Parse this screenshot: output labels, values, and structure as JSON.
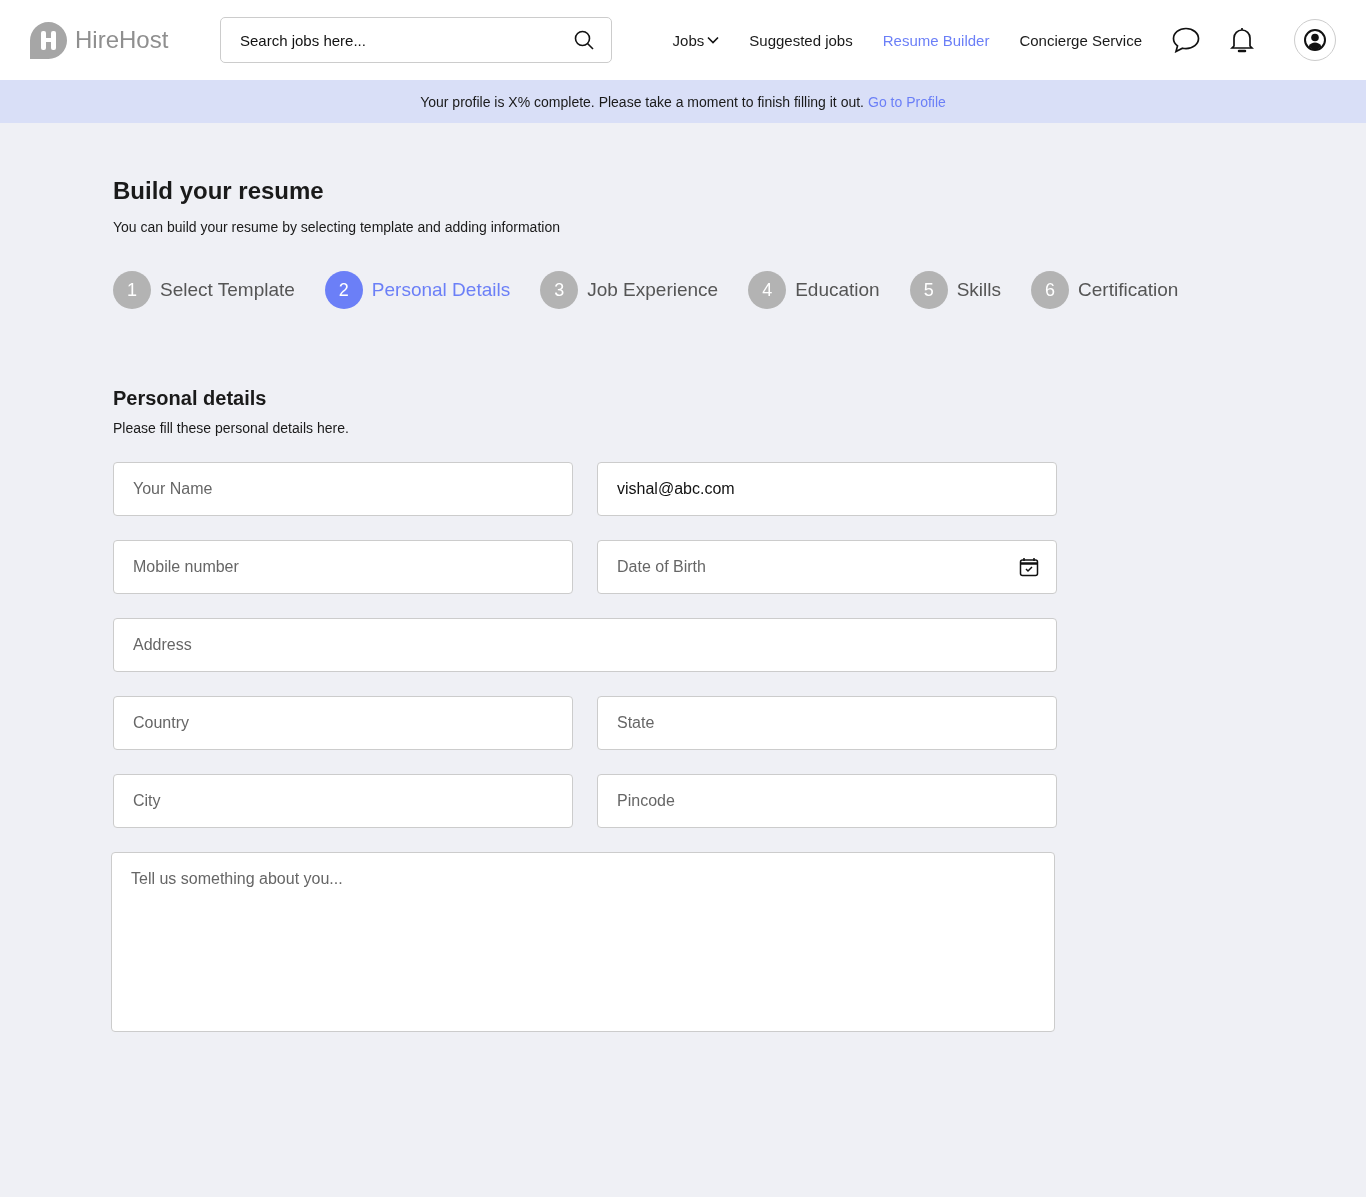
{
  "header": {
    "logo": "HireHost",
    "search": {
      "placeholder": "Search jobs here..."
    },
    "nav": [
      {
        "label": "Jobs",
        "kind": "dropdown",
        "selected": false
      },
      {
        "label": "Suggested jobs",
        "kind": "link",
        "selected": false
      },
      {
        "label": "Resume Builder",
        "kind": "link",
        "selected": true
      },
      {
        "label": "Concierge Service",
        "kind": "link",
        "selected": false
      }
    ]
  },
  "banner": {
    "message": "Your profile is X% complete. Please take a moment to finish filling it out.",
    "link": "Go to Profile"
  },
  "page": {
    "title": "Build your resume",
    "subtitle": "You can build your resume by selecting template and adding information"
  },
  "steps": [
    {
      "number": "1",
      "label": "Select Template",
      "selected": false
    },
    {
      "number": "2",
      "label": "Personal Details",
      "selected": true
    },
    {
      "number": "3",
      "label": "Job Experience",
      "selected": false
    },
    {
      "number": "4",
      "label": "Education",
      "selected": false
    },
    {
      "number": "5",
      "label": "Skills",
      "selected": false
    },
    {
      "number": "6",
      "label": "Certification",
      "selected": false
    }
  ],
  "section": {
    "title": "Personal details",
    "subtitle": "Please fill these personal details here."
  },
  "field_rows": [
    [
      {
        "kind": "text",
        "placeholder": "Your Name"
      },
      {
        "kind": "text",
        "value": "vishal@abc.com"
      }
    ],
    [
      {
        "kind": "text",
        "placeholder": "Mobile number"
      },
      {
        "kind": "date",
        "placeholder": "Date of Birth"
      }
    ],
    [
      {
        "kind": "text",
        "placeholder": "Address"
      }
    ],
    [
      {
        "kind": "text",
        "placeholder": "Country"
      },
      {
        "kind": "text",
        "placeholder": "State"
      }
    ],
    [
      {
        "kind": "text",
        "placeholder": "City"
      },
      {
        "kind": "text",
        "placeholder": "Pincode"
      }
    ],
    [
      {
        "kind": "textarea",
        "placeholder": "Tell us something about you..."
      }
    ]
  ]
}
